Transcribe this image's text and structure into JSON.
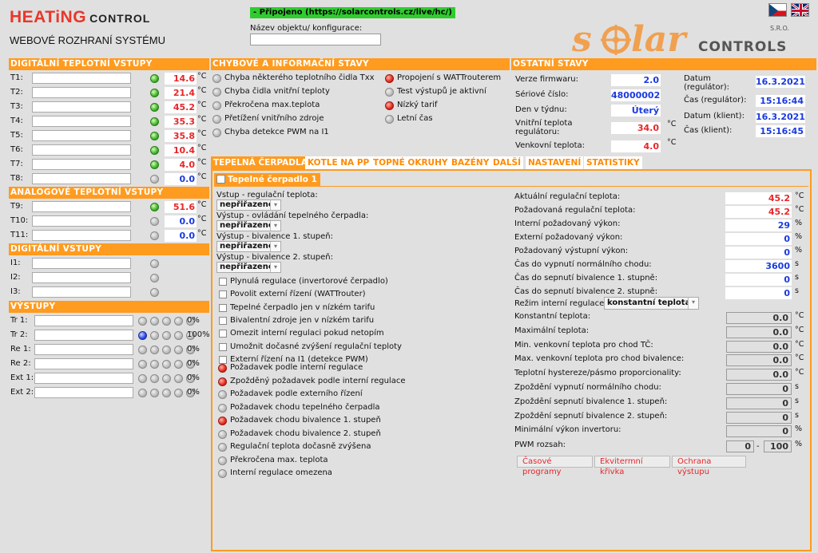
{
  "header": {
    "brand_main": "HEATiNG",
    "brand_sub": "CONTROL",
    "subtitle": "WEBOVÉ ROZHRANÍ SYSTÉMU",
    "connection": "- Připojeno (https://solarcontrols.cz/live/hc/)",
    "object_label": "Název objektu/ konfigurace:",
    "object_value": "",
    "logo_main": "solar",
    "logo_sro": "S.R.O.",
    "logo_sub": "CONTROLS"
  },
  "colors": {
    "accent": "#ff9b1f",
    "value_red": "#e8262a",
    "value_blue": "#1a3ae0",
    "connected": "#2ecc2e"
  },
  "digital_temp": {
    "title": "DIGITÁLNÍ TEPLOTNÍ VSTUPY",
    "rows": [
      {
        "label": "T1:",
        "led": "green",
        "value": "14.6",
        "color": "red",
        "unit": "°C"
      },
      {
        "label": "T2:",
        "led": "green",
        "value": "21.4",
        "color": "red",
        "unit": "°C"
      },
      {
        "label": "T3:",
        "led": "green",
        "value": "45.2",
        "color": "red",
        "unit": "°C"
      },
      {
        "label": "T4:",
        "led": "green",
        "value": "35.3",
        "color": "red",
        "unit": "°C"
      },
      {
        "label": "T5:",
        "led": "green",
        "value": "35.8",
        "color": "red",
        "unit": "°C"
      },
      {
        "label": "T6:",
        "led": "green",
        "value": "10.4",
        "color": "red",
        "unit": "°C"
      },
      {
        "label": "T7:",
        "led": "green",
        "value": "4.0",
        "color": "red",
        "unit": "°C"
      },
      {
        "label": "T8:",
        "led": "grey",
        "value": "0.0",
        "color": "blue",
        "unit": "°C"
      }
    ]
  },
  "analog_temp": {
    "title": "ANALOGOVÉ TEPLOTNÍ VSTUPY",
    "rows": [
      {
        "label": "T9:",
        "led": "green",
        "value": "51.6",
        "color": "red",
        "unit": "°C"
      },
      {
        "label": "T10:",
        "led": "grey",
        "value": "0.0",
        "color": "blue",
        "unit": "°C"
      },
      {
        "label": "T11:",
        "led": "grey",
        "value": "0.0",
        "color": "blue",
        "unit": "°C"
      }
    ]
  },
  "digital_in": {
    "title": "DIGITÁLNÍ VSTUPY",
    "rows": [
      {
        "label": "I1:"
      },
      {
        "label": "I2:"
      },
      {
        "label": "I3:"
      }
    ]
  },
  "outputs": {
    "title": "VÝSTUPY",
    "rows": [
      {
        "label": "Tr 1:",
        "leds": [
          "grey",
          "grey",
          "grey",
          "grey",
          "grey"
        ],
        "value": "0%"
      },
      {
        "label": "Tr 2:",
        "leds": [
          "blue",
          "grey",
          "grey",
          "grey",
          "grey"
        ],
        "value": "100%"
      },
      {
        "label": "Re 1:",
        "leds": [
          "grey",
          "grey",
          "grey",
          "grey",
          "grey"
        ],
        "value": "0%"
      },
      {
        "label": "Re 2:",
        "leds": [
          "grey",
          "grey",
          "grey",
          "grey",
          "grey"
        ],
        "value": "0%"
      },
      {
        "label": "Ext 1:",
        "leds": [
          "grey",
          "grey",
          "grey",
          "grey",
          "grey"
        ],
        "value": "0%"
      },
      {
        "label": "Ext 2:",
        "leds": [
          "grey",
          "grey",
          "grey",
          "grey",
          "grey"
        ],
        "value": "0%"
      }
    ]
  },
  "errors": {
    "title": "CHYBOVÉ A INFORMAČNÍ STAVY",
    "col1": [
      {
        "led": "grey",
        "label": "Chyba některého teplotního čidla Txx"
      },
      {
        "led": "grey",
        "label": "Chyba čidla vnitřní teploty"
      },
      {
        "led": "grey",
        "label": "Překročena max.teplota"
      },
      {
        "led": "grey",
        "label": "Přetížení vnitřního zdroje"
      },
      {
        "led": "grey",
        "label": "Chyba detekce PWM na I1"
      }
    ],
    "col2": [
      {
        "led": "red",
        "label": "Propojení s WATTrouterem"
      },
      {
        "led": "grey",
        "label": "Test výstupů je aktivní"
      },
      {
        "led": "red",
        "label": "Nízký tarif"
      },
      {
        "led": "grey",
        "label": "Letní čas"
      }
    ]
  },
  "other": {
    "title": "OSTATNÍ STAVY",
    "left": [
      {
        "label": "Verze firmwaru:",
        "value": "2.0",
        "color": "blue",
        "unit": ""
      },
      {
        "label": "Sériové číslo:",
        "value": "48000002",
        "color": "blue",
        "unit": ""
      },
      {
        "label": "Den v týdnu:",
        "value": "Úterý",
        "color": "blue",
        "unit": ""
      },
      {
        "label": "Vnitřní teplota regulátoru:",
        "value": "34.0",
        "color": "red",
        "unit": "°C"
      },
      {
        "label": "Venkovní teplota:",
        "value": "4.0",
        "color": "red",
        "unit": "°C"
      }
    ],
    "right": [
      {
        "label": "Datum (regulátor):",
        "value": "16.3.2021"
      },
      {
        "label": "Čas (regulátor):",
        "value": "15:16:44"
      },
      {
        "label": "Datum (klient):",
        "value": "16.3.2021"
      },
      {
        "label": "Čas (klient):",
        "value": "15:16:45"
      }
    ]
  },
  "tabs": [
    "TEPELNÁ ČERPADLA",
    "KOTLE NA PP",
    "TOPNÉ OKRUHY",
    "BAZÉNY",
    "DALŠÍ",
    "NASTAVENÍ",
    "STATISTIKY"
  ],
  "pump": {
    "subtab": "Tepelné čerpadlo 1",
    "selects": [
      {
        "label": "Vstup - regulační teplota:",
        "value": "nepřiřazeno"
      },
      {
        "label": "Výstup - ovládání tepelného čerpadla:",
        "value": "nepřiřazeno"
      },
      {
        "label": "Výstup - bivalence 1. stupeň:",
        "value": "nepřiřazeno"
      },
      {
        "label": "Výstup - bivalence 2. stupeň:",
        "value": "nepřiřazeno"
      }
    ],
    "checkboxes": [
      "Plynulá regulace (invertorové čerpadlo)",
      "Povolit externí řízení (WATTrouter)",
      "Tepelné čerpadlo jen v nízkém tarifu",
      "Bivalentní zdroje jen v nízkém tarifu",
      "Omezit interní regulaci pokud netopím",
      "Umožnit dočasné zvýšení regulační teploty",
      "Externí řízení na I1 (detekce PWM)"
    ],
    "status": [
      {
        "led": "red",
        "label": "Požadavek podle interní regulace"
      },
      {
        "led": "red",
        "label": "Zpožděný požadavek podle interní regulace"
      },
      {
        "led": "grey",
        "label": "Požadavek podle externího řízení"
      },
      {
        "led": "grey",
        "label": "Požadavek chodu tepelného čerpadla"
      },
      {
        "led": "red",
        "label": "Požadavek chodu bivalence 1. stupeň"
      },
      {
        "led": "grey",
        "label": "Požadavek chodu bivalence 2. stupeň"
      },
      {
        "led": "grey",
        "label": "Regulační teplota dočasně zvýšena"
      },
      {
        "led": "grey",
        "label": "Překročena max. teplota"
      },
      {
        "led": "grey",
        "label": "Interní regulace omezena"
      }
    ],
    "live": [
      {
        "label": "Aktuální regulační teplota:",
        "value": "45.2",
        "color": "red",
        "unit": "°C"
      },
      {
        "label": "Požadovaná regulační teplota:",
        "value": "45.2",
        "color": "red",
        "unit": "°C"
      },
      {
        "label": "Interní požadovaný výkon:",
        "value": "29",
        "color": "blue",
        "unit": "%"
      },
      {
        "label": "Externí požadovaný výkon:",
        "value": "0",
        "color": "blue",
        "unit": "%"
      },
      {
        "label": "Požadovaný výstupní výkon:",
        "value": "0",
        "color": "blue",
        "unit": "%"
      },
      {
        "label": "Čas do vypnutí normálního chodu:",
        "value": "3600",
        "color": "blue",
        "unit": "s"
      },
      {
        "label": "Čas do sepnutí bivalence 1. stupně:",
        "value": "0",
        "color": "blue",
        "unit": "s"
      },
      {
        "label": "Čas do sepnutí bivalence 2. stupně:",
        "value": "0",
        "color": "blue",
        "unit": "s"
      }
    ],
    "mode_label": "Režim interní regulace:",
    "mode_value": "konstantní teplota",
    "params": [
      {
        "label": "Konstantní teplota:",
        "value": "0.0",
        "unit": "°C"
      },
      {
        "label": "Maximální teplota:",
        "value": "0.0",
        "unit": "°C"
      },
      {
        "label": "Min. venkovní teplota pro chod TČ:",
        "value": "0.0",
        "unit": "°C"
      },
      {
        "label": "Max. venkovní teplota pro chod bivalence:",
        "value": "0.0",
        "unit": "°C"
      },
      {
        "label": "Teplotní hystereze/pásmo proporcionality:",
        "value": "0.0",
        "unit": "°C"
      },
      {
        "label": "Zpoždění vypnutí normálního chodu:",
        "value": "0",
        "unit": "s"
      },
      {
        "label": "Zpoždění sepnutí bivalence 1. stupeň:",
        "value": "0",
        "unit": "s"
      },
      {
        "label": "Zpoždění sepnutí bivalence 2. stupeň:",
        "value": "0",
        "unit": "s"
      },
      {
        "label": "Minimální výkon invertoru:",
        "value": "0",
        "unit": "%"
      }
    ],
    "pwm_label": "PWM rozsah:",
    "pwm_min": "0",
    "pwm_sep": "-",
    "pwm_max": "100",
    "pwm_unit": "%",
    "buttons": [
      "Časové programy",
      "Ekvitermní křivka",
      "Ochrana výstupu"
    ]
  }
}
